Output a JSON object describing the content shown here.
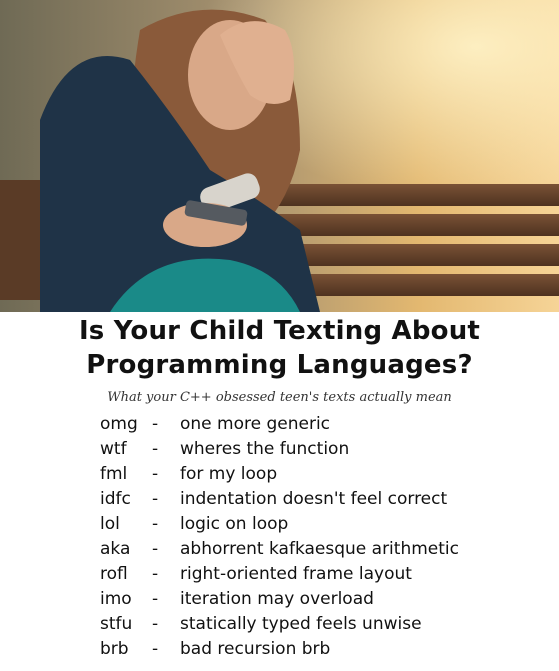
{
  "headline": {
    "line1": "Is Your Child Texting About",
    "line2": "Programming Languages?"
  },
  "subtitle": "What your C++ obsessed teen's texts actually mean",
  "dash": "-",
  "entries": [
    {
      "abbr": "omg",
      "meaning": "one more generic"
    },
    {
      "abbr": "wtf",
      "meaning": "wheres the function"
    },
    {
      "abbr": "fml",
      "meaning": "for my loop"
    },
    {
      "abbr": "idfc",
      "meaning": "indentation doesn't feel correct"
    },
    {
      "abbr": "lol",
      "meaning": "logic on loop"
    },
    {
      "abbr": "aka",
      "meaning": "abhorrent kafkaesque arithmetic"
    },
    {
      "abbr": "rofl",
      "meaning": "right-oriented frame layout"
    },
    {
      "abbr": "imo",
      "meaning": "iteration may overload"
    },
    {
      "abbr": "stfu",
      "meaning": "statically typed feels unwise"
    },
    {
      "abbr": "brb",
      "meaning": "bad recursion brb"
    }
  ],
  "colors": {
    "text": "#111111",
    "background": "#ffffff",
    "jacket": "#1f3347",
    "hair": "#8a5a3a",
    "warm_light": "#f2c57a"
  }
}
